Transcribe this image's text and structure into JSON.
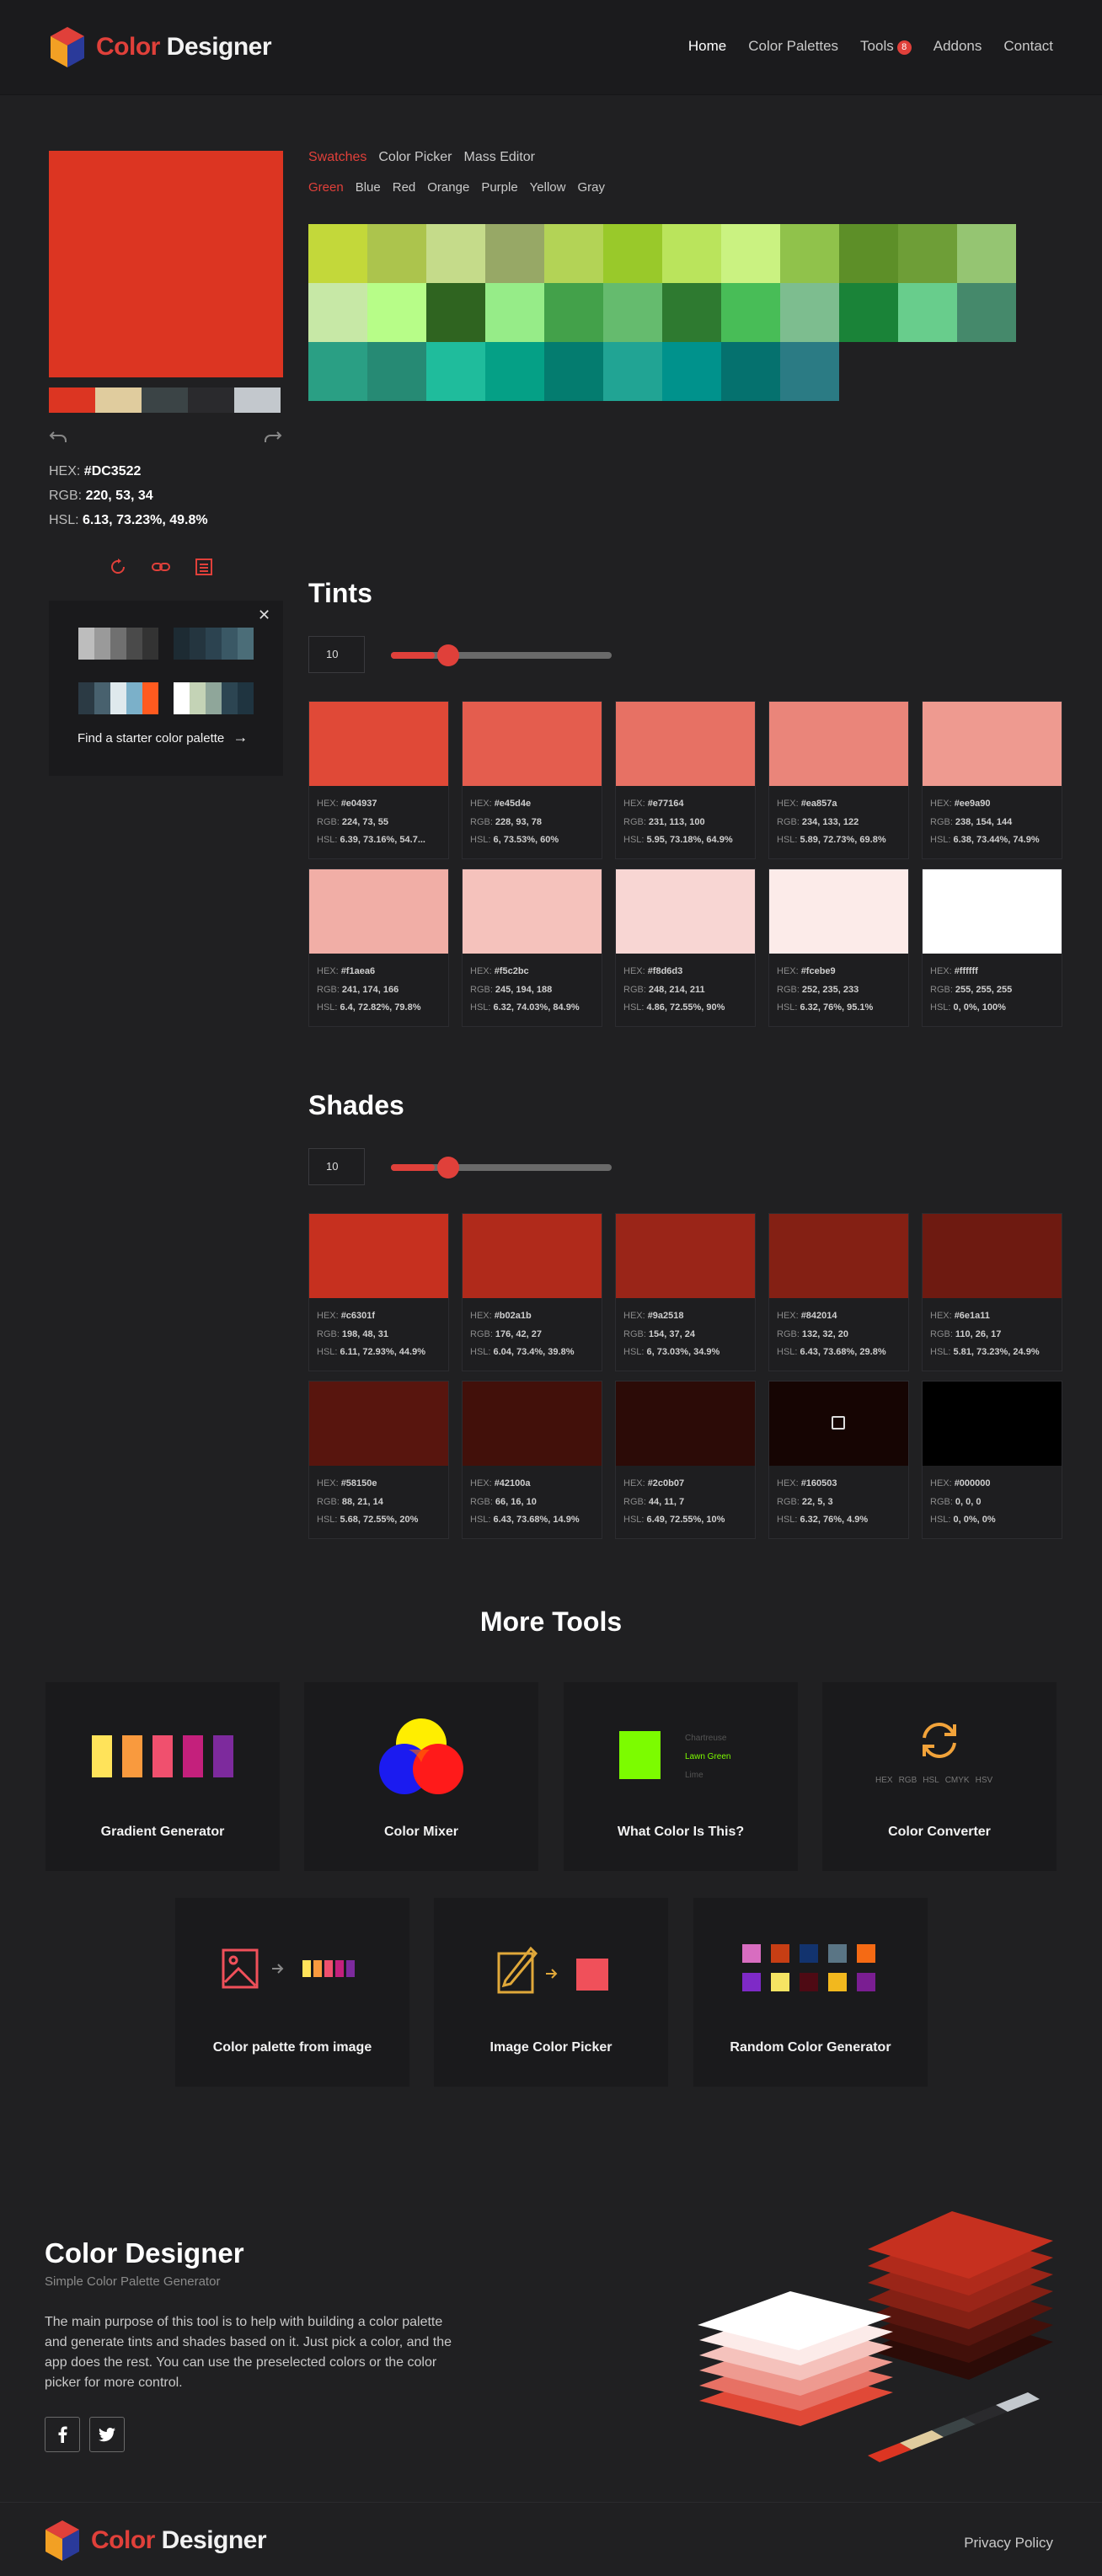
{
  "brand": {
    "part1": "Color",
    "part2": " Designer"
  },
  "nav": {
    "home": "Home",
    "palettes": "Color Palettes",
    "tools": "Tools",
    "tools_badge": "8",
    "addons": "Addons",
    "contact": "Contact"
  },
  "selected": {
    "color": "#DC3522",
    "hex_label": "HEX:",
    "hex": "#DC3522",
    "rgb_label": "RGB:",
    "rgb": "220, 53, 34",
    "hsl_label": "HSL:",
    "hsl": "6.13, 73.23%, 49.8%"
  },
  "history_colors": [
    "#dc3522",
    "#e0cc9e",
    "#3b4446",
    "#2a2a2d",
    "#c3c8cd"
  ],
  "starter": {
    "label": "Find a starter color palette"
  },
  "tabs": {
    "swatches": "Swatches",
    "picker": "Color Picker",
    "mass": "Mass Editor"
  },
  "color_tabs": [
    "Green",
    "Blue",
    "Red",
    "Orange",
    "Purple",
    "Yellow",
    "Gray"
  ],
  "swatch_grid": [
    [
      "#c3d83a",
      "#acc44d",
      "#c5db8a",
      "#97a866",
      "#b3d356",
      "#99c92a",
      "#bae45c",
      "#caf281",
      "#90c24b",
      "#5d8f28",
      "#6e9e37",
      "#95c572"
    ],
    [
      "#c7e8a6",
      "#b7fd88",
      "#2f6420",
      "#96ec88",
      "#43a14a",
      "#65bb6e",
      "#2e7a30",
      "#48bd57",
      "#7dbd8f",
      "#1a8338",
      "#68cd8c",
      "#45896b"
    ],
    [
      "#2a9f84",
      "#268a74",
      "#1fbc9c",
      "#05a086",
      "#047c6f",
      "#21a494",
      "#00928c",
      "#05716e",
      "#2b7b84"
    ]
  ],
  "tints": {
    "title": "Tints",
    "steps": "10",
    "slider_value": 0.2,
    "items": [
      {
        "color": "#e04937",
        "hex": "#e04937",
        "rgb": "224, 73, 55",
        "hsl": "6.39, 73.16%, 54.7..."
      },
      {
        "color": "#e45d4e",
        "hex": "#e45d4e",
        "rgb": "228, 93, 78",
        "hsl": "6, 73.53%, 60%"
      },
      {
        "color": "#e77164",
        "hex": "#e77164",
        "rgb": "231, 113, 100",
        "hsl": "5.95, 73.18%, 64.9%"
      },
      {
        "color": "#ea857a",
        "hex": "#ea857a",
        "rgb": "234, 133, 122",
        "hsl": "5.89, 72.73%, 69.8%"
      },
      {
        "color": "#ee9a90",
        "hex": "#ee9a90",
        "rgb": "238, 154, 144",
        "hsl": "6.38, 73.44%, 74.9%"
      },
      {
        "color": "#f1aea6",
        "hex": "#f1aea6",
        "rgb": "241, 174, 166",
        "hsl": "6.4, 72.82%, 79.8%"
      },
      {
        "color": "#f5c2bc",
        "hex": "#f5c2bc",
        "rgb": "245, 194, 188",
        "hsl": "6.32, 74.03%, 84.9%"
      },
      {
        "color": "#f8d6d3",
        "hex": "#f8d6d3",
        "rgb": "248, 214, 211",
        "hsl": "4.86, 72.55%, 90%"
      },
      {
        "color": "#fcebe9",
        "hex": "#fcebe9",
        "rgb": "252, 235, 233",
        "hsl": "6.32, 76%, 95.1%"
      },
      {
        "color": "#ffffff",
        "hex": "#ffffff",
        "rgb": "255, 255, 255",
        "hsl": "0, 0%, 100%"
      }
    ]
  },
  "shades": {
    "title": "Shades",
    "steps": "10",
    "slider_value": 0.2,
    "items": [
      {
        "color": "#c6301f",
        "hex": "#c6301f",
        "rgb": "198, 48, 31",
        "hsl": "6.11, 72.93%, 44.9%"
      },
      {
        "color": "#b02a1b",
        "hex": "#b02a1b",
        "rgb": "176, 42, 27",
        "hsl": "6.04, 73.4%, 39.8%"
      },
      {
        "color": "#9a2518",
        "hex": "#9a2518",
        "rgb": "154, 37, 24",
        "hsl": "6, 73.03%, 34.9%"
      },
      {
        "color": "#842014",
        "hex": "#842014",
        "rgb": "132, 32, 20",
        "hsl": "6.43, 73.68%, 29.8%"
      },
      {
        "color": "#6e1a11",
        "hex": "#6e1a11",
        "rgb": "110, 26, 17",
        "hsl": "5.81, 73.23%, 24.9%"
      },
      {
        "color": "#58150e",
        "hex": "#58150e",
        "rgb": "88, 21, 14",
        "hsl": "5.68, 72.55%, 20%"
      },
      {
        "color": "#42100a",
        "hex": "#42100a",
        "rgb": "66, 16, 10",
        "hsl": "6.43, 73.68%, 14.9%"
      },
      {
        "color": "#2c0b07",
        "hex": "#2c0b07",
        "rgb": "44, 11, 7",
        "hsl": "6.49, 72.55%, 10%"
      },
      {
        "color": "#160503",
        "hex": "#160503",
        "rgb": "22, 5, 3",
        "hsl": "6.32, 76%, 4.9%"
      },
      {
        "color": "#000000",
        "hex": "#000000",
        "rgb": "0, 0, 0",
        "hsl": "0, 0%, 0%"
      }
    ]
  },
  "labels": {
    "hex": "HEX:",
    "rgb": "RGB:",
    "hsl": "HSL:"
  },
  "more_tools": {
    "title": "More Tools",
    "gradient": "Gradient Generator",
    "mixer": "Color Mixer",
    "what_color": "What Color Is This?",
    "what_color_names": [
      "Chartreuse",
      "Lawn Green",
      "Lime"
    ],
    "converter": "Color Converter",
    "converter_formats": [
      "HEX",
      "RGB",
      "HSL",
      "CMYK",
      "HSV"
    ],
    "palette_from_image": "Color palette from image",
    "image_picker": "Image Color Picker",
    "random": "Random Color Generator"
  },
  "footer": {
    "title": "Color Designer",
    "subtitle": "Simple Color Palette Generator",
    "description": "The main purpose of this tool is to help with building a color palette and generate tints and shades based on it. Just pick a color, and the app does the rest. You can use the preselected colors or the color picker for more control.",
    "privacy": "Privacy Policy"
  }
}
